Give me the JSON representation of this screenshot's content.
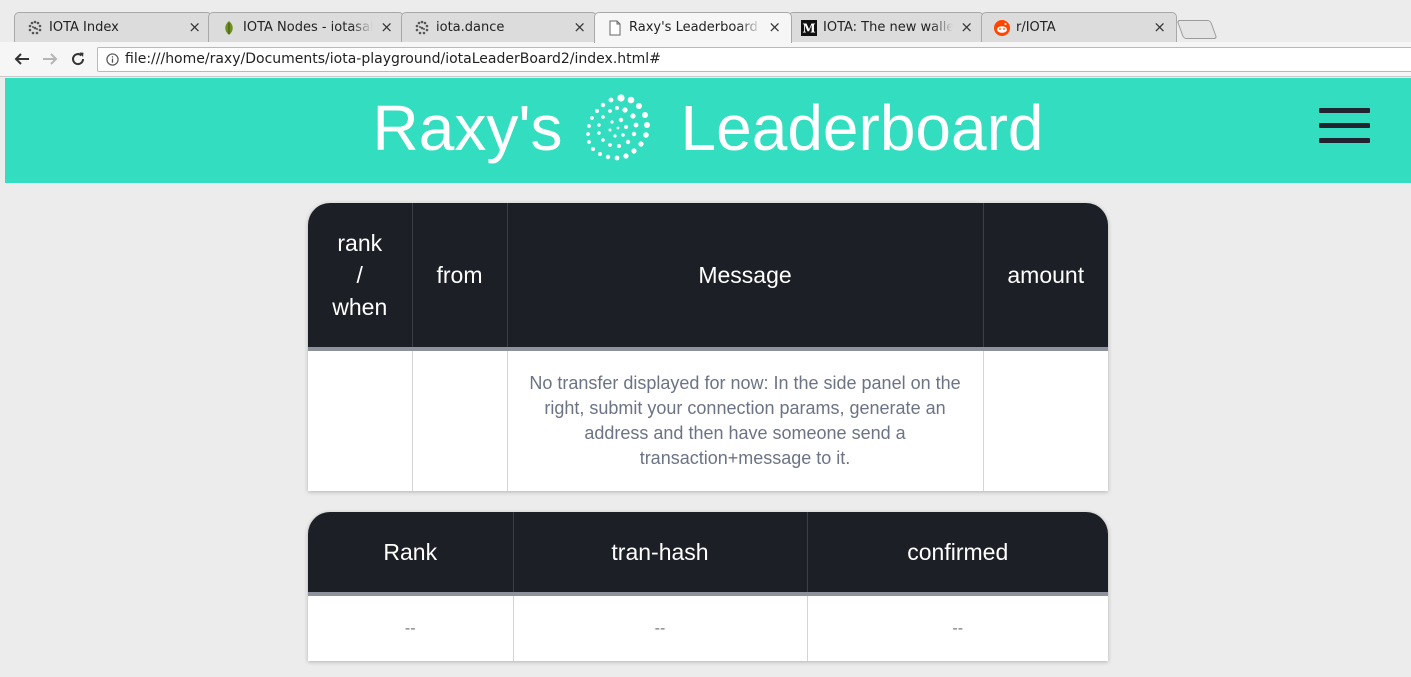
{
  "browser": {
    "tabs": [
      {
        "title": "IOTA Index",
        "icon": "iota-icon",
        "active": false
      },
      {
        "title": "IOTA Nodes - iotasalad",
        "icon": "leaf-icon",
        "active": false
      },
      {
        "title": "iota.dance",
        "icon": "iota-icon",
        "active": false
      },
      {
        "title": "Raxy's Leaderboard (ele",
        "icon": "page-icon",
        "active": true
      },
      {
        "title": "IOTA: The new wallets (",
        "icon": "medium-icon",
        "active": false
      },
      {
        "title": "r/IOTA",
        "icon": "reddit-icon",
        "active": false
      }
    ],
    "close_glyph": "×",
    "address_bar": {
      "url": "file:///home/raxy/Documents/iota-playground/iotaLeaderBoard2/index.html#"
    }
  },
  "header": {
    "title_left": "Raxy's",
    "title_right": "Leaderboard",
    "background": "#33ddc0"
  },
  "transfers_table": {
    "columns": [
      "rank\n/\nwhen",
      "from",
      "Message",
      "amount"
    ],
    "rows": [
      {
        "rank": "",
        "from": "",
        "message": "No transfer displayed for now: In the side panel on the right, submit your connection params, generate an address and then have someone send a transaction+message to it.",
        "amount": ""
      }
    ]
  },
  "confirm_table": {
    "columns": [
      "Rank",
      "tran-hash",
      "confirmed"
    ],
    "rows": [
      {
        "rank": "--",
        "hash": "--",
        "confirmed": "--"
      }
    ]
  },
  "colors": {
    "accent": "#33ddc0",
    "table_header": "#1c1f26",
    "hamburger": "#1f2430"
  }
}
